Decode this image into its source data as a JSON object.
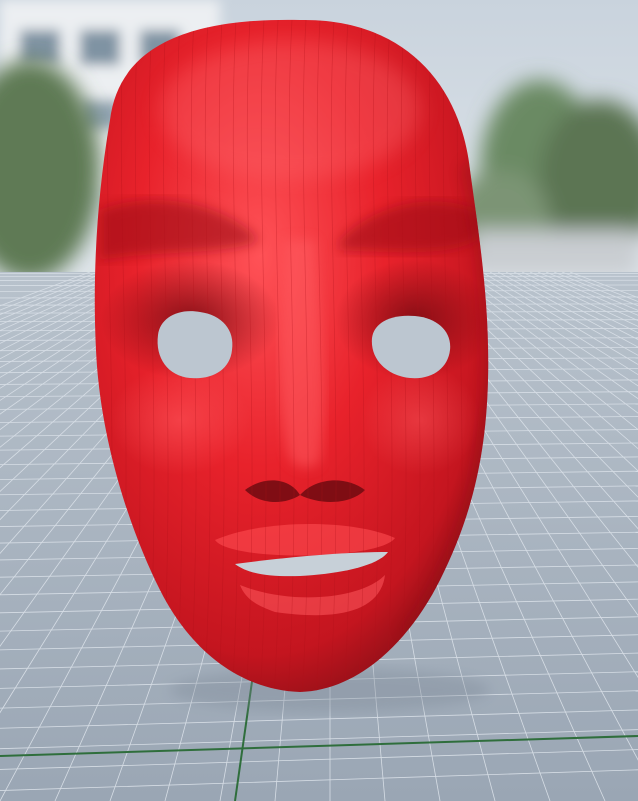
{
  "scene": {
    "subject": "red-face-mask",
    "environment": "3d-viewport-grid-floor",
    "colors": {
      "sky_top": "#c9d3dd",
      "sky_bottom": "#dfe5ea",
      "floor": "#a3afbd",
      "floor_far": "#b8c2cc",
      "grid_line": "#d6dde5",
      "axis_line": "#2f6e3c",
      "mask_base": "#e8222b",
      "mask_light": "#ff4a4f",
      "mask_shadow": "#8e0f17",
      "foliage": "#5f7a55",
      "building": "#e9ecef"
    }
  }
}
